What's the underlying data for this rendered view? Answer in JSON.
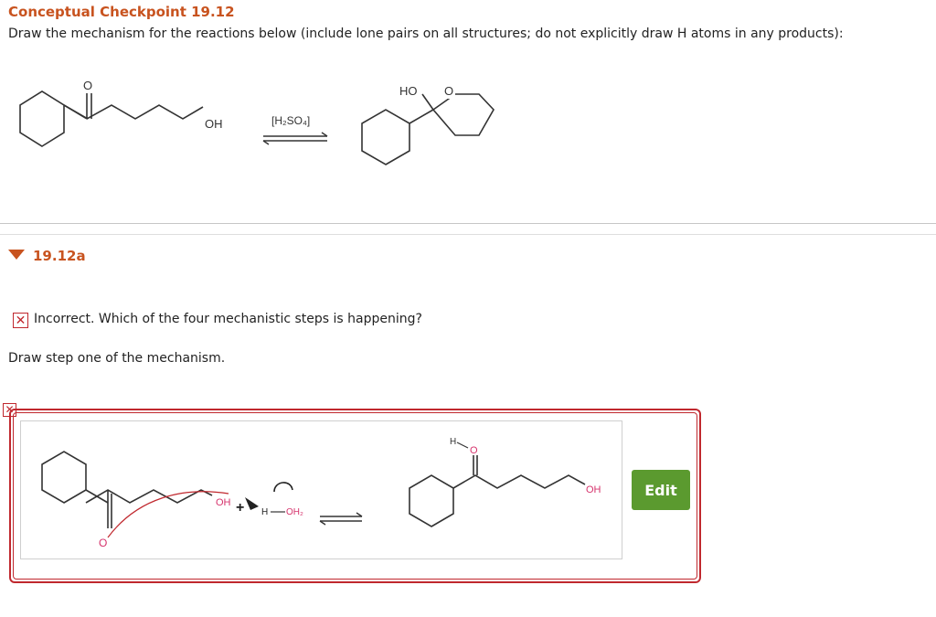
{
  "header": {
    "title": "Conceptual Checkpoint 19.12",
    "instruction": "Draw the mechanism for the reactions below (include lone pairs on all structures; do not explicitly draw H atoms in any products):"
  },
  "reaction": {
    "reactant_oxygen": "O",
    "reactant_hydroxyl": "OH",
    "catalyst": "[H₂SO₄]",
    "product_hydroxyl": "HO",
    "product_ring_oxygen": "O"
  },
  "section": {
    "label": "19.12a"
  },
  "feedback": {
    "icon": "✕",
    "text": "Incorrect. Which of the four mechanistic steps is happening?"
  },
  "prompt": "Draw step one of the mechanism.",
  "answer": {
    "x_icon": "✕",
    "left_oxygen": "O",
    "left_hydroxyl": "OH",
    "plus": "+",
    "acid_h": "H",
    "acid_oh2": "OH₂",
    "right_h": "H",
    "right_oxygen": "O",
    "right_hydroxyl": "OH",
    "edit_label": "Edit"
  },
  "colors": {
    "accent": "#c8531f",
    "error": "#c0282e",
    "edit_button": "#5b9a2f",
    "lone_pair": "#d6336c"
  }
}
